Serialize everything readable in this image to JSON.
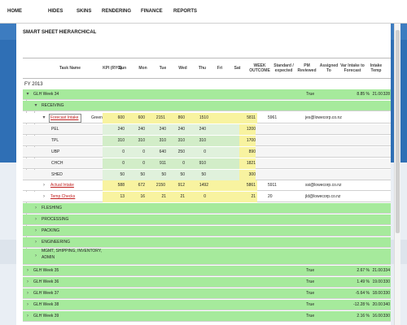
{
  "nav": [
    "HOME",
    "HIDES",
    "SKINS",
    "RENDERING",
    "FINANCE",
    "REPORTS"
  ],
  "page_title": "SMART SHEET HIERARCHICAL",
  "columns": {
    "task": "Task Name",
    "kpi": "KPI (RYG)",
    "sun": "Sun",
    "mon": "Mon",
    "tue": "Tue",
    "wed": "Wed",
    "thu": "Thu",
    "fri": "Fri",
    "sat": "Sat",
    "week_outcome": "WEEK OUTCOME",
    "standard": "Standard / expected",
    "pm_reviewed": "PM Reviewed",
    "assigned": "Assigned To",
    "var_intake": "Var Intake to Forecast",
    "intake_temp": "Intake Temp"
  },
  "fy_label": "FY 2013",
  "rows": [
    {
      "task": "GLH Week 34",
      "pm": "True",
      "var": "8.85 %",
      "num": "21.00",
      "temp": "328"
    },
    {
      "task": "RECEIVING"
    },
    {
      "task": "Forecast Intake",
      "kpi": "Green",
      "sun": "600",
      "mon": "600",
      "tue": "2151",
      "wed": "860",
      "thu": "1510",
      "outcome": "5811",
      "std": "5961",
      "assigned": "jes@lowecorp.co.nz"
    },
    {
      "task": "PEL",
      "sun": "240",
      "mon": "240",
      "tue": "240",
      "wed": "240",
      "thu": "240",
      "outcome": "1200"
    },
    {
      "task": "TPL",
      "sun": "310",
      "mon": "310",
      "tue": "310",
      "wed": "310",
      "thu": "310",
      "outcome": "1700"
    },
    {
      "task": "UBP",
      "sun": "0",
      "mon": "0",
      "tue": "640",
      "wed": "250",
      "thu": "0",
      "outcome": "890"
    },
    {
      "task": "CHCH",
      "sun": "0",
      "mon": "0",
      "tue": "911",
      "wed": "0",
      "thu": "910",
      "outcome": "1821"
    },
    {
      "task": "SHED",
      "sun": "50",
      "mon": "50",
      "tue": "50",
      "wed": "50",
      "thu": "50",
      "outcome": "300"
    },
    {
      "task": "Actual Intake",
      "sun": "588",
      "mon": "672",
      "tue": "2150",
      "wed": "912",
      "thu": "1492",
      "outcome": "5861",
      "std": "5911",
      "assigned": "ssi@lowecorp.co.nz"
    },
    {
      "task": "Temp Checks",
      "sun": "13",
      "mon": "16",
      "tue": "21",
      "wed": "21",
      "thu": "0",
      "outcome": "21",
      "std": "20",
      "assigned": "jld@lowecorp.co.nz"
    },
    {
      "task": "FLESHING"
    },
    {
      "task": "PROCESSING"
    },
    {
      "task": "PACKING"
    },
    {
      "task": "ENGINEERING"
    },
    {
      "task": "MGMT, SHIPPING, INVENTORY,",
      "task2": "ADMIN"
    },
    {
      "task": "GLH Week 35",
      "pm": "True",
      "var": "2.67 %",
      "num": "21.00",
      "temp": "334"
    },
    {
      "task": "GLH Week 36",
      "pm": "True",
      "var": "1.49 %",
      "num": "19.00",
      "temp": "330"
    },
    {
      "task": "GLH Week 37",
      "pm": "True",
      "var": "-5.64 %",
      "num": "18.00",
      "temp": "330"
    },
    {
      "task": "GLH Week 38",
      "pm": "True",
      "var": "-12.28 %",
      "num": "20.00",
      "temp": "340"
    },
    {
      "task": "GLH Week 39",
      "pm": "True",
      "var": "2.16 %",
      "num": "16.00",
      "temp": "330"
    }
  ],
  "icons": {
    "expanded": "▾",
    "collapsed": "›"
  },
  "colors": {
    "group_green": "#a6ea9c",
    "highlight_yellow": "#f8f3a0",
    "light_green": "#e0f1dc",
    "link_red": "#c0201f",
    "page_blue": "#2f6fb5"
  }
}
